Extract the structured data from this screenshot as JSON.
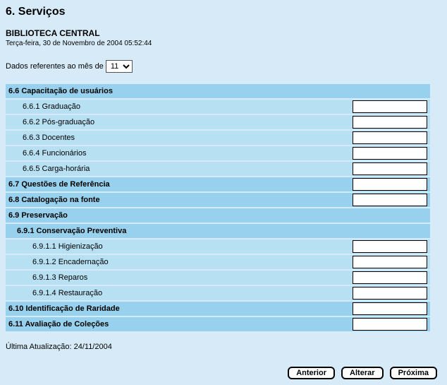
{
  "page": {
    "title": "6. Serviços",
    "subtitle": "BIBLIOTECA CENTRAL",
    "timestamp": "Terça-feira, 30 de Novembro de 2004 05:52:44",
    "month_label": "Dados referentes ao mês de",
    "month_value": "11",
    "last_update_label": "Última Atualização: 24/11/2004"
  },
  "sections": {
    "s66": {
      "label": "6.6 Capacitação de usuários"
    },
    "s661": {
      "label": "6.6.1 Graduação",
      "value": ""
    },
    "s662": {
      "label": "6.6.2 Pós-graduação",
      "value": ""
    },
    "s663": {
      "label": "6.6.3 Docentes",
      "value": ""
    },
    "s664": {
      "label": "6.6.4 Funcionários",
      "value": ""
    },
    "s665": {
      "label": "6.6.5 Carga-horária",
      "value": ""
    },
    "s67": {
      "label": "6.7 Questões de Referência",
      "value": ""
    },
    "s68": {
      "label": "6.8 Catalogação na fonte",
      "value": ""
    },
    "s69": {
      "label": "6.9 Preservação"
    },
    "s691": {
      "label": "6.9.1 Conservação Preventiva"
    },
    "s6911": {
      "label": "6.9.1.1 Higienização",
      "value": ""
    },
    "s6912": {
      "label": "6.9.1.2 Encadernação",
      "value": ""
    },
    "s6913": {
      "label": "6.9.1.3 Reparos",
      "value": ""
    },
    "s6914": {
      "label": "6.9.1.4 Restauração",
      "value": ""
    },
    "s610": {
      "label": "6.10 Identificação de Raridade",
      "value": ""
    },
    "s611": {
      "label": "6.11 Avaliação de Coleções",
      "value": ""
    }
  },
  "buttons": {
    "prev": "Anterior",
    "alter": "Alterar",
    "next": "Próxima"
  }
}
